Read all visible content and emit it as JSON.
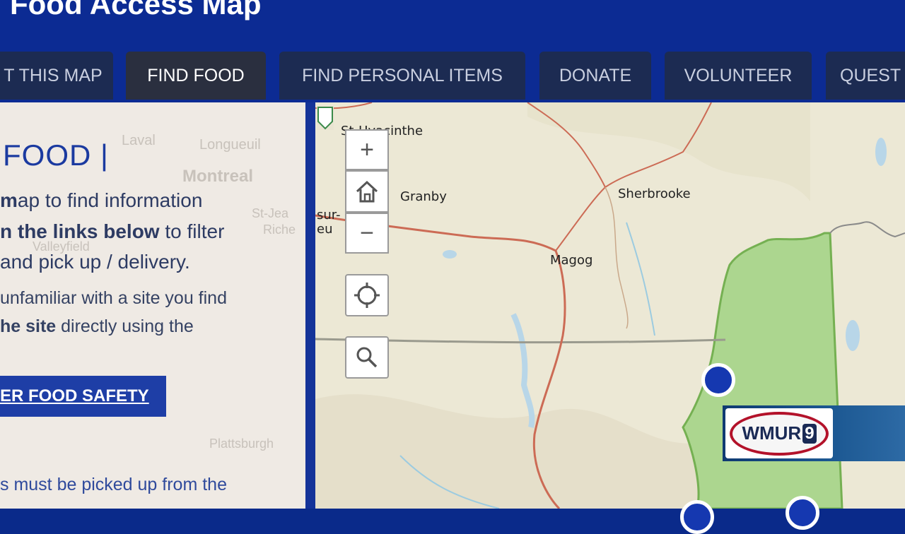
{
  "header": {
    "title": "Food Access Map",
    "tabs": [
      {
        "label": "T THIS MAP",
        "active": false
      },
      {
        "label": "FIND FOOD",
        "active": true
      },
      {
        "label": "FIND PERSONAL ITEMS",
        "active": false
      },
      {
        "label": "DONATE",
        "active": false
      },
      {
        "label": "VOLUNTEER",
        "active": false
      },
      {
        "label": "QUEST",
        "active": false
      }
    ]
  },
  "panel": {
    "ghost_labels": [
      "Laval",
      "Longueuil",
      "Montreal",
      "St-Jea",
      "Riche",
      "Valleyfield",
      "Plattsburgh"
    ],
    "title": "FOOD |",
    "line1": "ap to find information",
    "line2_bold": "n the links below",
    "line2_rest": " to filter",
    "line3": "and pick up / delivery.",
    "line4": "unfamiliar with a site you find",
    "line5_bold": "he site",
    "line5_rest": " directly using the",
    "safety_button": "ER FOOD SAFETY",
    "line6": "s must be picked up from the"
  },
  "map": {
    "cities": [
      "St-Hyacinthe",
      "Granby",
      "Sherbrooke",
      "Magog",
      "sur-",
      "eu"
    ],
    "controls": {
      "zoom_in": "+",
      "home": "home-icon",
      "zoom_out": "−",
      "locate": "locate-icon",
      "search": "search-icon"
    }
  },
  "overlay": {
    "logo_text": "WMUR",
    "logo_number": "9"
  },
  "colors": {
    "header_bg": "#0c2b93",
    "tab_bg": "#1c2b52",
    "active_tab_bg": "#2a2f3f",
    "accent": "#1e3ea6",
    "state_green": "#a8d48a",
    "marker": "#1538b0"
  }
}
